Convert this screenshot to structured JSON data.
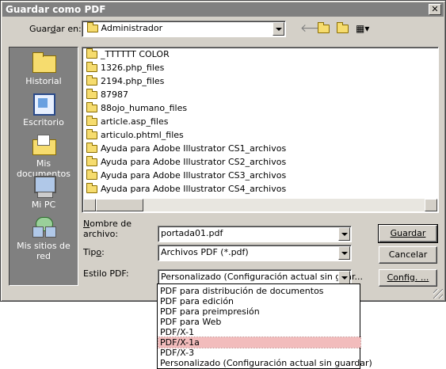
{
  "window": {
    "title": "Guardar como PDF",
    "close": "✕"
  },
  "save_in": {
    "label_pre": "Guar",
    "label_u": "d",
    "label_post": "ar en:",
    "value": "Administrador"
  },
  "places": [
    {
      "label": "Historial",
      "icon": "history-icon"
    },
    {
      "label": "Escritorio",
      "icon": "desktop-icon"
    },
    {
      "label": "Mis documentos",
      "icon": "my-documents-icon"
    },
    {
      "label": "Mi PC",
      "icon": "my-computer-icon"
    },
    {
      "label": "Mis sitios de red",
      "icon": "network-places-icon"
    }
  ],
  "files": [
    "_TTTTTT COLOR",
    "1326.php_files",
    "2194.php_files",
    "87987",
    "88ojo_humano_files",
    "article.asp_files",
    "articulo.phtml_files",
    "Ayuda para Adobe Illustrator CS1_archivos",
    "Ayuda para Adobe Illustrator CS2_archivos",
    "Ayuda para Adobe Illustrator CS3_archivos",
    "Ayuda para Adobe Illustrator CS4_archivos"
  ],
  "filename": {
    "label_u": "N",
    "label_rest1": "ombre de",
    "label_rest2": "archivo:",
    "value": "portada01.pdf"
  },
  "filetype": {
    "label_pre": "Tip",
    "label_u": "o",
    "label_post": ":",
    "value": "Archivos PDF (*.pdf)"
  },
  "pdfstyle": {
    "label": "Estilo PDF:",
    "value": "Personalizado (Configuración actual sin guar..."
  },
  "buttons": {
    "save": "Guardar",
    "cancel": "Cancelar",
    "config": "Config. ..."
  },
  "dropdown_options": [
    "PDF para distribución de documentos",
    "PDF para edición",
    "PDF para preimpresión",
    "PDF para Web",
    "PDF/X-1",
    "PDF/X-1a",
    "PDF/X-3",
    "Personalizado (Configuración actual sin guardar)"
  ],
  "dropdown_selected_index": 5
}
